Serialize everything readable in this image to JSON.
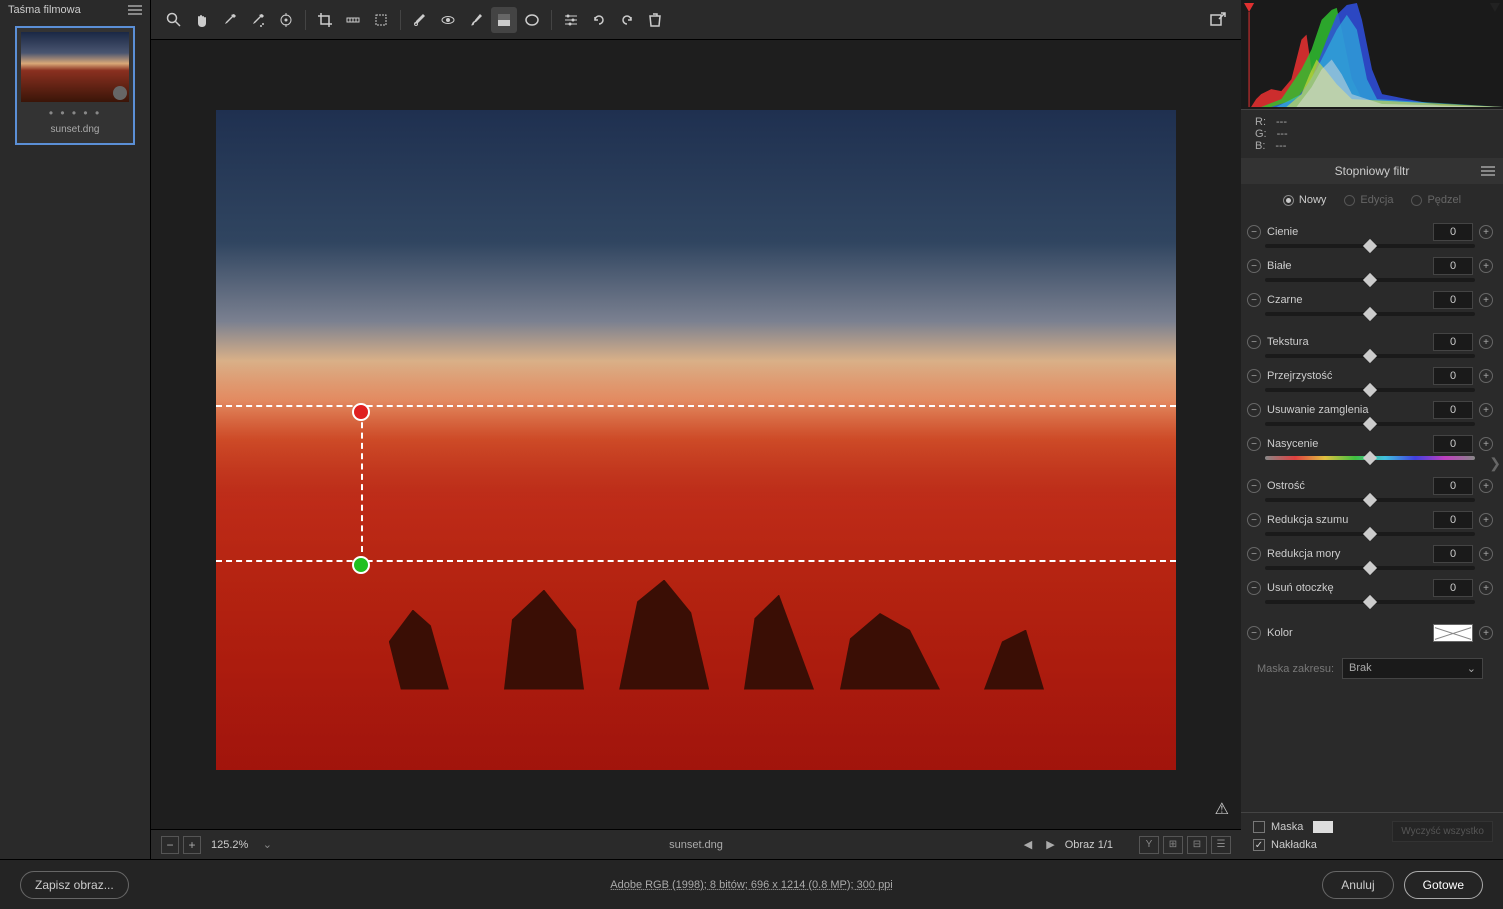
{
  "filmstrip": {
    "title": "Taśma filmowa",
    "thumb_name": "sunset.dng"
  },
  "toolbar_icons": [
    "zoom",
    "hand",
    "eyedrop",
    "eyedrop-plus",
    "eyedrop-target",
    "crop",
    "straighten",
    "transform",
    "spot",
    "redeye",
    "brush",
    "grad-rect",
    "grad-radial",
    "list",
    "rotate-ccw",
    "rotate-cw",
    "trash"
  ],
  "zoom": {
    "value": "125.2%"
  },
  "filename": "sunset.dng",
  "image_nav": "Obraz 1/1",
  "rgb": {
    "r": "R:",
    "g": "G:",
    "b": "B:",
    "val": "---"
  },
  "panel_title": "Stopniowy filtr",
  "modes": [
    {
      "label": "Nowy",
      "checked": true
    },
    {
      "label": "Edycja",
      "checked": false
    },
    {
      "label": "Pędzel",
      "checked": false
    }
  ],
  "sliders": {
    "group1": [
      {
        "label": "Cienie",
        "val": "0"
      },
      {
        "label": "Białe",
        "val": "0"
      },
      {
        "label": "Czarne",
        "val": "0"
      }
    ],
    "group2": [
      {
        "label": "Tekstura",
        "val": "0"
      },
      {
        "label": "Przejrzystość",
        "val": "0"
      },
      {
        "label": "Usuwanie zamglenia",
        "val": "0"
      },
      {
        "label": "Nasycenie",
        "val": "0",
        "rainbow": true
      }
    ],
    "group3": [
      {
        "label": "Ostrość",
        "val": "0"
      },
      {
        "label": "Redukcja szumu",
        "val": "0"
      },
      {
        "label": "Redukcja mory",
        "val": "0"
      },
      {
        "label": "Usuń otoczkę",
        "val": "0"
      }
    ]
  },
  "color_label": "Kolor",
  "mask_range": {
    "label": "Maska zakresu:",
    "value": "Brak"
  },
  "checks": {
    "mask": "Maska",
    "overlay": "Nakładka"
  },
  "clear": "Wyczyść wszystko",
  "footer": {
    "save": "Zapisz obraz...",
    "info": "Adobe RGB (1998); 8 bitów; 696 x 1214 (0.8 MP); 300 ppi",
    "cancel": "Anuluj",
    "done": "Gotowe"
  }
}
